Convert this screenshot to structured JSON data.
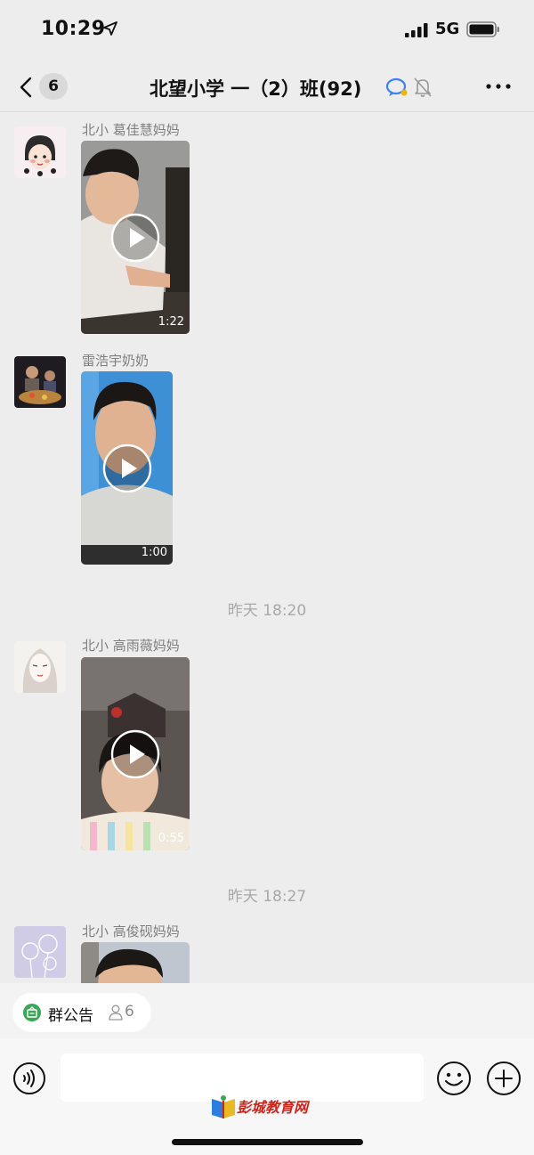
{
  "status_bar": {
    "time": "10:29",
    "network": "5G"
  },
  "nav": {
    "unread_count": "6",
    "title": "北望小学 一（2）班(92)"
  },
  "messages": [
    {
      "sender": "北小 葛佳慧妈妈",
      "video_duration": "1:22",
      "avatar_icon": "cartoon-girl-avatar"
    },
    {
      "sender": "雷浩宇奶奶",
      "video_duration": "1:00",
      "avatar_icon": "family-dinner-photo-avatar"
    },
    {
      "sender": "北小 高雨薇妈妈",
      "video_duration": "0:55",
      "avatar_icon": "sketch-girl-avatar"
    },
    {
      "sender": "北小 高俊砚妈妈",
      "avatar_icon": "dandelion-avatar"
    }
  ],
  "timestamps": [
    "昨天 18:20",
    "昨天 18:27"
  ],
  "notice": {
    "label": "群公告",
    "count": "6"
  },
  "input": {
    "placeholder": ""
  },
  "watermark": {
    "text": "彭城教育网"
  },
  "colors": {
    "background": "#ededed",
    "notice_green": "#3aa757",
    "watermark_red": "#d0241b"
  }
}
